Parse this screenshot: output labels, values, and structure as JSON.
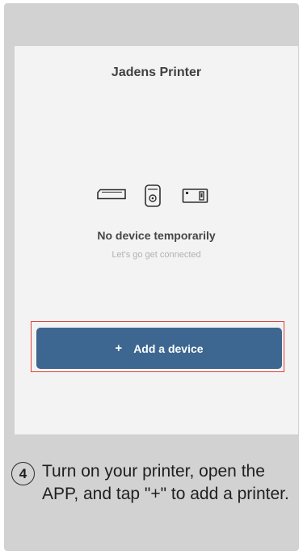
{
  "app": {
    "title": "Jadens Printer"
  },
  "empty_state": {
    "title": "No device temporarily",
    "subtitle": "Let's go get connected",
    "icons": [
      "label-printer-icon",
      "portable-printer-icon",
      "wide-printer-icon"
    ]
  },
  "actions": {
    "add_plus": "+",
    "add_label": "Add a device"
  },
  "instruction": {
    "step": "4",
    "text": "Turn on your printer, open the APP, and tap \"+\" to add a printer."
  },
  "colors": {
    "card_background": "#d2d2d2",
    "screen_background": "#f3f3f3",
    "button": "#3d6790",
    "highlight": "#e0403a"
  }
}
